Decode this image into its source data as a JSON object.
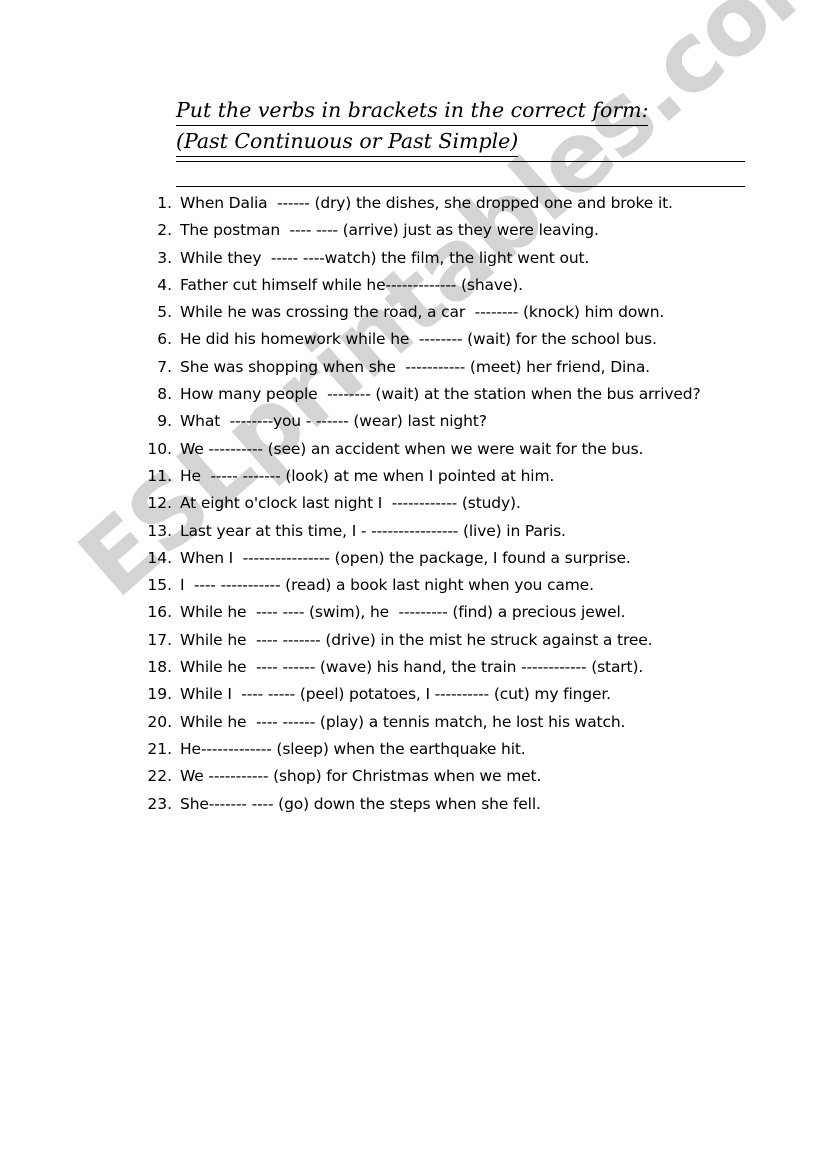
{
  "document": {
    "title_line1": "Put the verbs in brackets in the correct form:",
    "title_line2": "(Past Continuous or Past Simple)",
    "watermark": "ESLprintables.com",
    "watermark_color": "#d4d4d4",
    "text_color": "#000000",
    "background_color": "#ffffff"
  },
  "exercises": [
    {
      "number": "1.",
      "text": "When Dalia  ------ (dry) the dishes, she dropped one and broke it."
    },
    {
      "number": "2.",
      "text": "The postman  ---- ---- (arrive) just as they were leaving."
    },
    {
      "number": "3.",
      "text": "While they  ----- ----watch) the film, the light went out."
    },
    {
      "number": "4.",
      "text": "Father cut himself while he------------- (shave)."
    },
    {
      "number": "5.",
      "text": "While he was crossing the road, a car  -------- (knock) him down."
    },
    {
      "number": "6.",
      "text": "He did his homework while he  -------- (wait) for the school bus."
    },
    {
      "number": "7.",
      "text": "She was shopping when she  ----------- (meet) her friend, Dina."
    },
    {
      "number": "8.",
      "text": "How many people  -------- (wait) at the station when the bus arrived?"
    },
    {
      "number": "9.",
      "text": "What  --------you - ------ (wear) last night?"
    },
    {
      "number": "10.",
      "text": "We ---------- (see) an accident when we were wait for the bus."
    },
    {
      "number": "11.",
      "text": "He  ----- ------- (look) at me when I pointed at him."
    },
    {
      "number": "12.",
      "text": "At eight o'clock last night I  ------------ (study)."
    },
    {
      "number": "13.",
      "text": "Last year at this time, I - ---------------- (live) in Paris."
    },
    {
      "number": "14.",
      "text": "When I  ---------------- (open) the package, I found a surprise."
    },
    {
      "number": "15.",
      "text": "I  ---- ----------- (read) a book last night when you came."
    },
    {
      "number": "16.",
      "text": "While he  ---- ---- (swim), he  --------- (find) a precious jewel."
    },
    {
      "number": "17.",
      "text": "While he  ---- ------- (drive) in the mist he struck against a tree."
    },
    {
      "number": "18.",
      "text": "While he  ---- ------ (wave) his hand, the train ------------ (start)."
    },
    {
      "number": "19.",
      "text": "While I  ---- ----- (peel) potatoes, I ---------- (cut) my finger."
    },
    {
      "number": "20.",
      "text": "While he  ---- ------ (play) a tennis match, he lost his watch."
    },
    {
      "number": "21.",
      "text": "He------------- (sleep) when the earthquake hit."
    },
    {
      "number": "22.",
      "text": "We ----------- (shop) for Christmas when we met."
    },
    {
      "number": "23.",
      "text": "She------- ---- (go) down the steps when she fell."
    }
  ]
}
